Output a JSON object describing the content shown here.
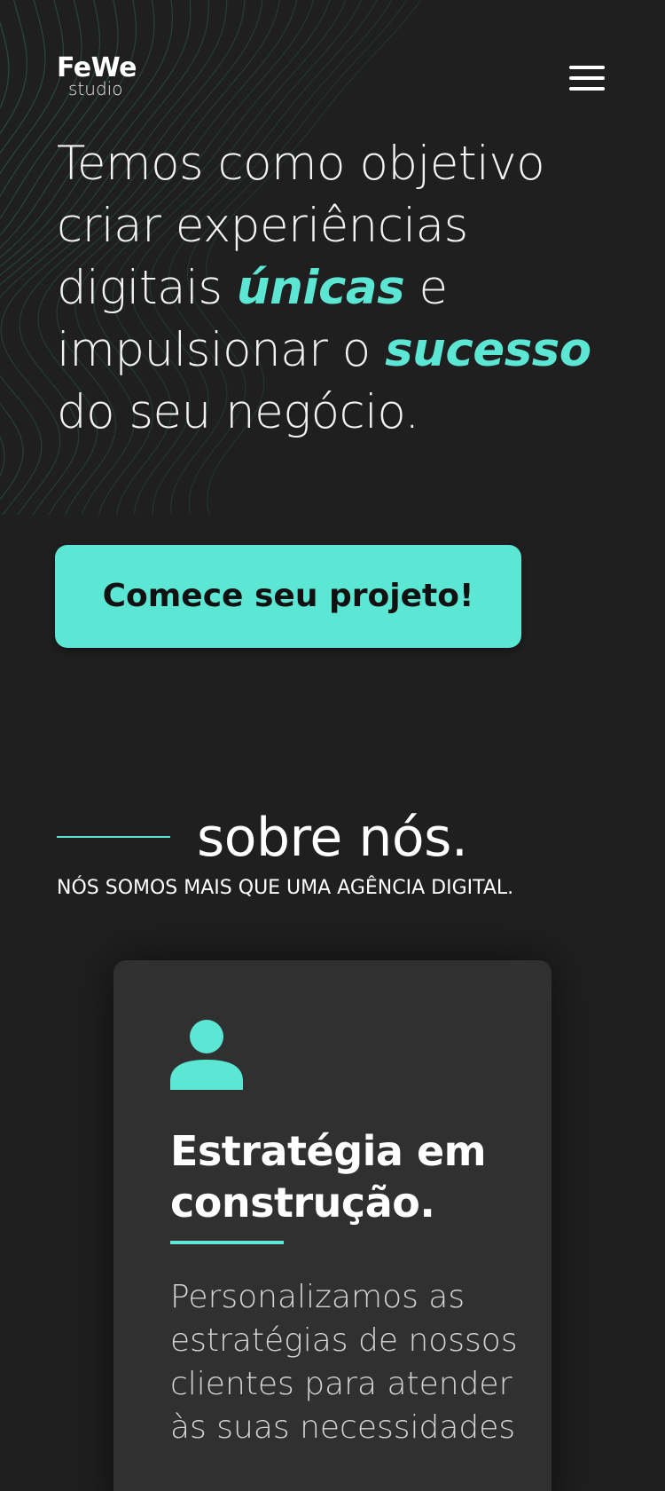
{
  "brand": {
    "name": "FeWe",
    "tagline": "studio"
  },
  "header": {
    "menu_icon": "hamburger-menu-icon"
  },
  "hero": {
    "text_before_1": "Temos como objetivo criar experiências digitais ",
    "accent_1": "únicas",
    "text_between": " e impulsionar o ",
    "accent_2": "sucesso",
    "text_after": " do seu negócio.",
    "cta_label": "Comece seu projeto!"
  },
  "about": {
    "title": "sobre nós.",
    "subtitle": "NÓS SOMOS MAIS QUE UMA AGÊNCIA DIGITAL."
  },
  "card": {
    "icon": "user-icon",
    "title": "Estratégia em construção.",
    "text": "Personalizamos as estratégias de nossos clientes para atender às suas necessidades"
  },
  "colors": {
    "background": "#1f1f1f",
    "accent": "#5ce6d4",
    "card_background": "#303030",
    "wave_lines": "#2f6f66"
  }
}
